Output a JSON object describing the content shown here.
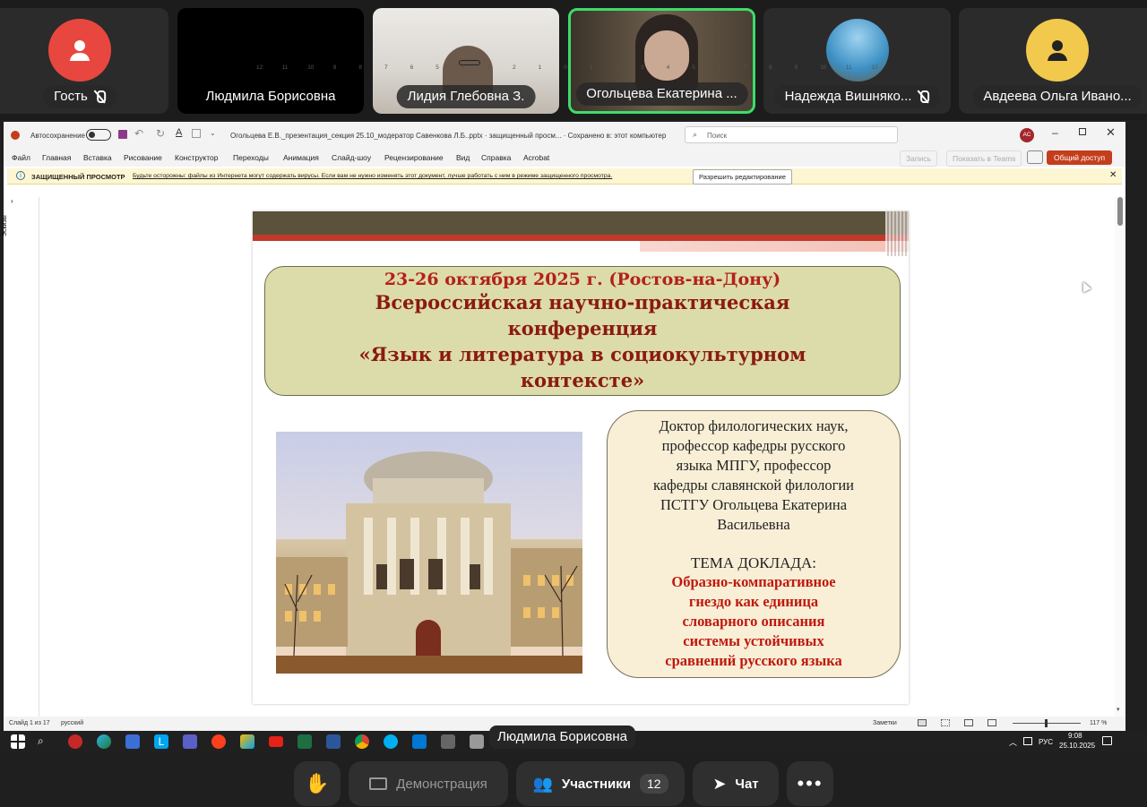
{
  "participants": [
    {
      "name": "Гость",
      "muted": true,
      "avatar": "user-icon",
      "avatar_color": "#e8473f"
    },
    {
      "name": "Людмила Борисовна",
      "muted": false
    },
    {
      "name": "Лидия Глебовна З.",
      "muted": false
    },
    {
      "name": "Огольцева Екатерина ...",
      "muted": false,
      "speaking": true
    },
    {
      "name": "Надежда Вишняко...",
      "muted": true
    },
    {
      "name": "Авдеева Ольга Ивано...",
      "muted": false,
      "avatar": "user-icon",
      "avatar_color": "#f2c94c"
    }
  ],
  "ppt": {
    "autosave": "Автосохранение",
    "filename": "Огольцева Е.В._презентация_секция 25.10_модератор Савенкова Л.Б..pptx  ·  защищенный просм...  ·  Сохранено в: этот компьютер",
    "search_placeholder": "Поиск",
    "user_initials": "АС",
    "menu": [
      "Файл",
      "Главная",
      "Вставка",
      "Рисование",
      "Конструктор",
      "Переходы",
      "Анимация",
      "Слайд-шоу",
      "Рецензирование",
      "Вид",
      "Справка",
      "Acrobat"
    ],
    "record": "Запись",
    "teams": "Показать в Teams",
    "share": "Общий доступ",
    "protected_title": "ЗАЩИЩЕННЫЙ ПРОСМОТР",
    "protected_msg": "Будьте осторожны: файлы из Интернета могут содержать вирусы. Если вам не нужно изменять этот документ, лучше работать с ним в режиме защищенного просмотра.",
    "enable_edit": "Разрешить редактирование",
    "thumbs_label": "Эскизы",
    "ruler": [
      "12",
      "11",
      "10",
      "9",
      "8",
      "7",
      "6",
      "5",
      "4",
      "3",
      "2",
      "1",
      "0",
      "1",
      "2",
      "3",
      "4",
      "5",
      "6",
      "7",
      "8",
      "9",
      "10",
      "11",
      "12"
    ],
    "status_slide": "Слайд 1 из 17",
    "status_lang": "русский",
    "notes": "Заметки",
    "zoom": "117 %"
  },
  "slide": {
    "dates": "23-26 октября 2025 г. (Ростов-на-Дону)",
    "title_lines": [
      "Всероссийская научно-практическая",
      "конференция",
      "«Язык и литература в социокультурном",
      "контексте»"
    ],
    "author_lines": [
      "Доктор филологических наук,",
      "профессор кафедры русского",
      "языка МПГУ, профессор",
      "кафедры славянской филологии",
      "ПСТГУ Огольцева Екатерина",
      "Васильевна"
    ],
    "tema": "ТЕМА ДОКЛАДА:",
    "topic_lines": [
      "Образно-компаративное",
      "гнездо как единица",
      "словарного описания",
      "системы устойчивых",
      "сравнений русского языка"
    ]
  },
  "taskbar": {
    "lang": "РУС",
    "time": "9:08",
    "date": "25.10.2025"
  },
  "speaker_label": "Людмила Борисовна",
  "controls": {
    "demo": "Демонстрация",
    "participants": "Участники",
    "count": "12",
    "chat": "Чат"
  }
}
